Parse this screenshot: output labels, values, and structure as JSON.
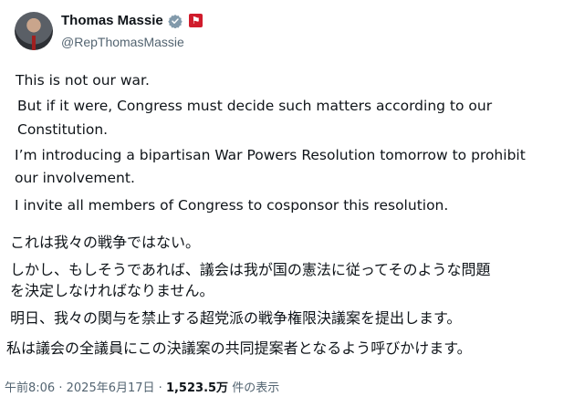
{
  "author": {
    "name": "Thomas Massie",
    "handle": "@RepThomasMassie",
    "badge_icon": "verified-badge-icon",
    "flag_icon": "government-flag-icon",
    "badge_color": "#829aab",
    "flag_color": "#d01c2c"
  },
  "tweet": {
    "en_lines": [
      "This is not our war.",
      "But if it were, Congress must decide such matters according to our",
      "Constitution.",
      "I’m introducing a bipartisan War Powers Resolution tomorrow to prohibit",
      "our involvement.",
      "I invite all members of Congress to cosponsor this resolution."
    ],
    "jp_lines": [
      "これは我々の戦争ではない。",
      "しかし、もしそうであれば、議会は我が国の憲法に従ってそのような問題",
      "を決定しなければなりません。",
      "明日、我々の関与を禁止する超党派の戦争権限決議案を提出します。",
      "私は議会の全議員にこの決議案の共同提案者となるよう呼びかけます。"
    ]
  },
  "meta": {
    "time": "午前8:06",
    "separator": "·",
    "date": "2025年6月17日",
    "views_count": "1,523.5万",
    "views_label": "件の表示"
  }
}
